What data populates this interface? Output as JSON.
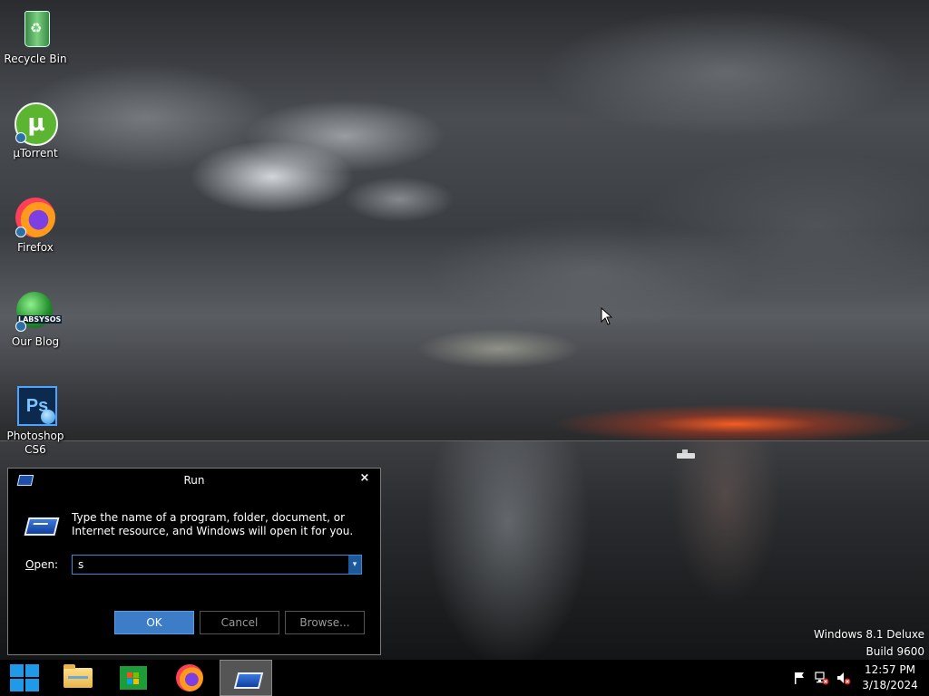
{
  "desktop": {
    "icons": [
      {
        "label": "Recycle Bin",
        "icon": "recycle-bin-icon"
      },
      {
        "label": "µTorrent",
        "icon": "utorrent-icon"
      },
      {
        "label": "Firefox",
        "icon": "firefox-icon"
      },
      {
        "label": "Our Blog",
        "icon": "blog-icon"
      },
      {
        "label": "Photoshop\nCS6",
        "icon": "photoshop-icon"
      }
    ],
    "blog_badge": "LABSYSOS",
    "ps_badge": "Ps",
    "utorrent_badge": "µ",
    "watermark": {
      "edition": "Windows 8.1 Deluxe",
      "build": "Build 9600"
    }
  },
  "run_dialog": {
    "title": "Run",
    "close": "×",
    "description": "Type the name of a program, folder, document, or Internet resource, and Windows will open it for you.",
    "open_label_prefix": "",
    "open_label_accel": "O",
    "open_label_rest": "pen:",
    "open_value": "s",
    "dropdown_glyph": "▾",
    "buttons": {
      "ok": "OK",
      "cancel": "Cancel",
      "browse": "Browse..."
    }
  },
  "taskbar": {
    "pinned": [
      "start-icon",
      "file-explorer-icon",
      "store-icon",
      "firefox-icon",
      "run-icon"
    ],
    "tray": [
      "flag-icon",
      "network-icon",
      "volume-muted-icon"
    ],
    "clock": {
      "time": "12:57 PM",
      "date": "3/18/2024"
    }
  },
  "colors": {
    "accent": "#3d7dc8",
    "taskbar": "#000000",
    "start": "#1f9ae8"
  }
}
